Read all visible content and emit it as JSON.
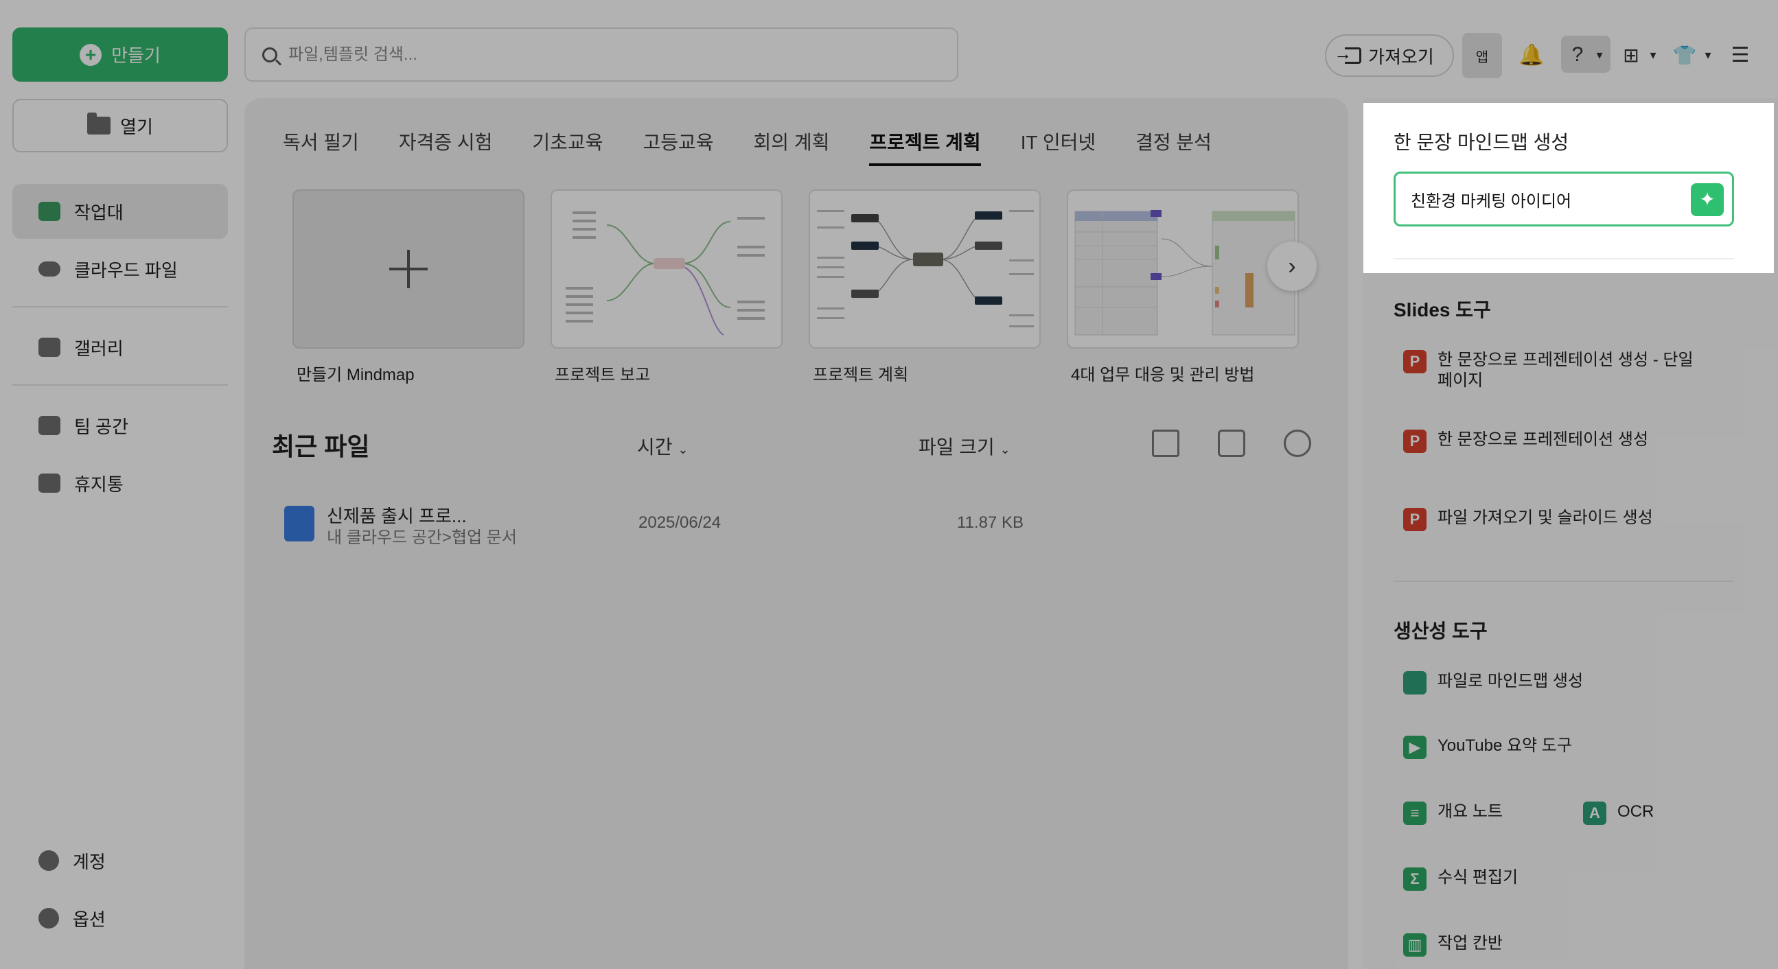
{
  "sidebar": {
    "create_label": "만들기",
    "open_label": "열기",
    "items": [
      {
        "label": "작업대"
      },
      {
        "label": "클라우드 파일"
      },
      {
        "label": "갤러리"
      },
      {
        "label": "팀 공간"
      },
      {
        "label": "휴지통"
      }
    ],
    "bottom": [
      {
        "label": "계정"
      },
      {
        "label": "옵션"
      }
    ]
  },
  "search": {
    "placeholder": "파일,템플릿 검색..."
  },
  "toolbar": {
    "import_label": "가져오기",
    "app_label": "앱"
  },
  "tabs": [
    {
      "label": "독서 필기"
    },
    {
      "label": "자격증 시험"
    },
    {
      "label": "기초교육"
    },
    {
      "label": "고등교육"
    },
    {
      "label": "회의 계획"
    },
    {
      "label": "프로젝트 계획"
    },
    {
      "label": "IT 인터넷"
    },
    {
      "label": "결정 분석"
    }
  ],
  "active_tab": 5,
  "templates": [
    {
      "label": "만들기 Mindmap"
    },
    {
      "label": "프로젝트 보고"
    },
    {
      "label": "프로젝트 계획"
    },
    {
      "label": "4대 업무 대응 및 관리 방법"
    }
  ],
  "recent": {
    "title": "최근 파일",
    "time_col": "시간",
    "size_col": "파일 크기",
    "files": [
      {
        "name": "신제품 출시 프로...",
        "path": "내 클라우드 공간>협업 문서",
        "date": "2025/06/24",
        "size": "11.87 KB"
      }
    ]
  },
  "right_panel": {
    "mindmap_title": "한 문장 마인드맵 생성",
    "mindmap_input_value": "친환경 마케팅 아이디어",
    "slides_title": "Slides 도구",
    "slides_tools": [
      {
        "label_line1": "한 문장으로 프레젠테이션 생성 - 단일",
        "label_line2": "페이지"
      },
      {
        "label": "한 문장으로 프레젠테이션 생성"
      },
      {
        "label": "파일 가져오기 및 슬라이드 생성"
      }
    ],
    "productivity_title": "생산성 도구",
    "productivity_tools": [
      {
        "label": "파일로 마인드맵 생성"
      },
      {
        "label": "YouTube 요약 도구"
      },
      {
        "label": "개요 노트"
      },
      {
        "label": "OCR"
      },
      {
        "label": "수식 편집기"
      },
      {
        "label": "작업 칸반"
      }
    ]
  },
  "colors": {
    "accent": "#33b66c",
    "focus_border": "#40c07a",
    "slides_icon": "#d9432f"
  }
}
